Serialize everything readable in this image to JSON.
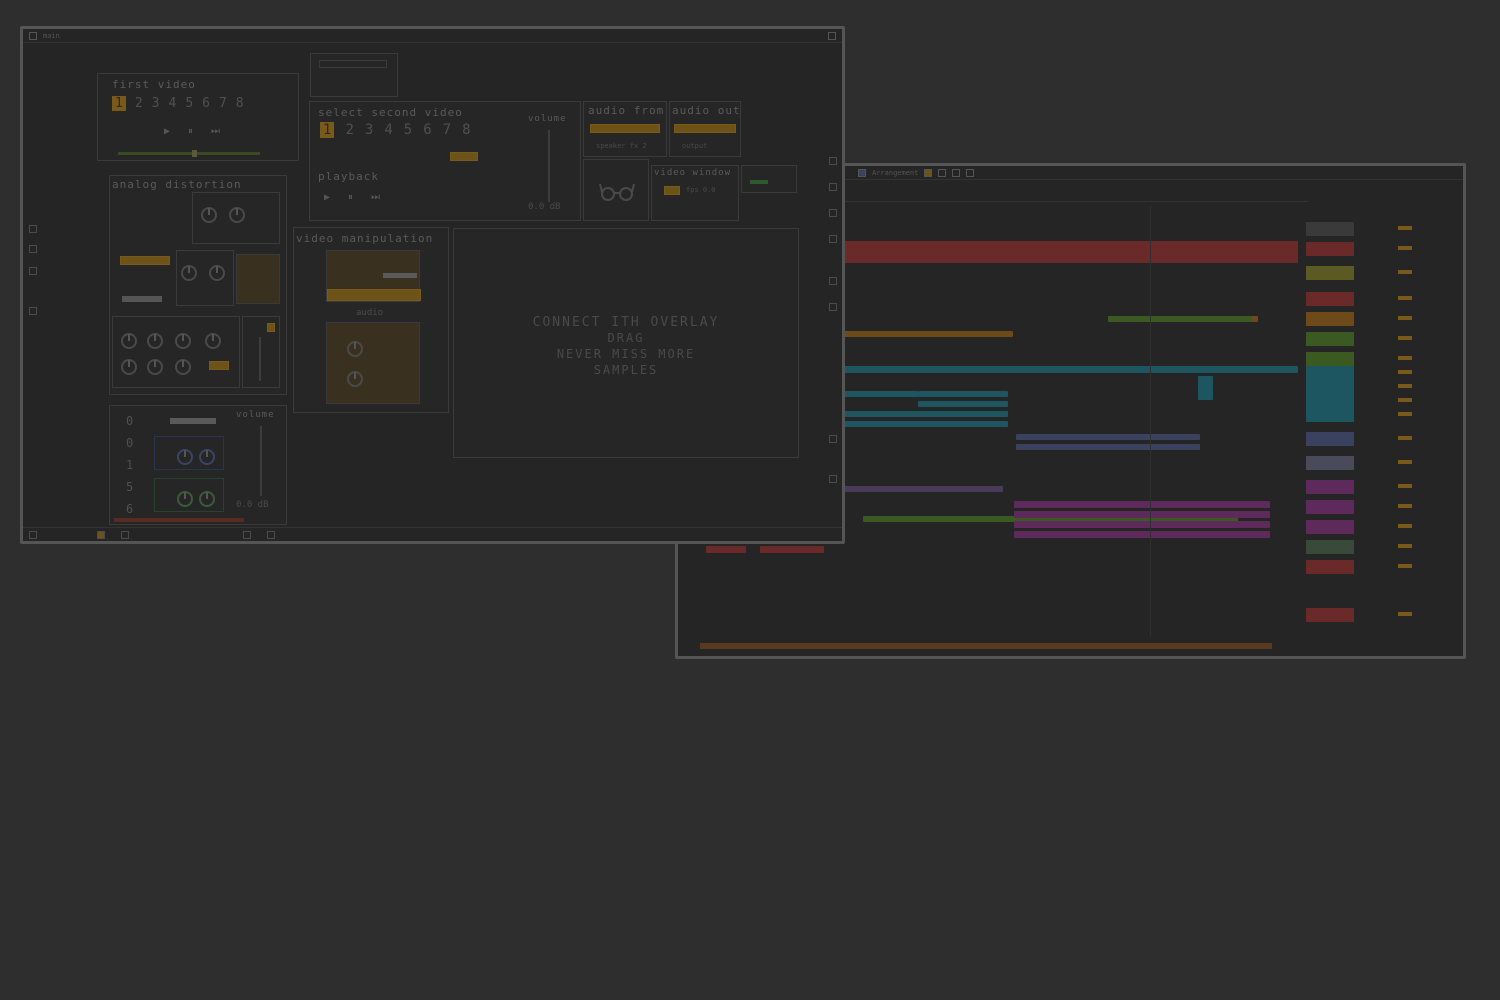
{
  "patch_window": {
    "title": "main",
    "first_video": {
      "title": "first video",
      "numbers": [
        "1",
        "2",
        "3",
        "4",
        "5",
        "6",
        "7",
        "8"
      ],
      "selected": "1",
      "controls": [
        "▶",
        "⏸",
        "⏭"
      ],
      "scrub_level": 0.52
    },
    "second_video": {
      "title": "select second video",
      "numbers": [
        "1",
        "2",
        "3",
        "4",
        "5",
        "6",
        "7",
        "8"
      ],
      "selected": "1",
      "volume_label": "volume",
      "playback_label": "playback",
      "controls": [
        "▶",
        "⏸",
        "⏭"
      ],
      "db_readout": "0.0 dB"
    },
    "audio_from": {
      "title": "audio from",
      "sub": "speaker fx 2"
    },
    "audio_out": {
      "title": "audio out",
      "sub": "output"
    },
    "video_window": {
      "title": "video window",
      "value": "fps 0.0"
    },
    "analog_distortion": {
      "title": "analog distortion"
    },
    "video_manipulation": {
      "title": "video manipulation",
      "sub": "audio"
    },
    "bottom_module": {
      "volume_label": "volume",
      "digits": [
        "0",
        "0",
        "1",
        "5",
        "6"
      ],
      "db_readout": "0.0 dB"
    },
    "video_screen": {
      "lines": [
        "CONNECT ITH OVERLAY",
        "DRAG",
        "NEVER MISS MORE",
        "SAMPLES"
      ]
    },
    "colors": {
      "accent": "#7a5a1a",
      "background": "#252525",
      "border": "#555555"
    }
  },
  "daw_window": {
    "title": "Arrangement",
    "colors": {
      "red": "#6a2a2a",
      "purple": "#4a3a5a",
      "orange": "#6e4a1a",
      "green": "#3a5a22",
      "cyan": "#1d5560",
      "blue": "#3a4260",
      "magenta": "#5e2a5c",
      "yellow": "#5a5a22"
    }
  }
}
